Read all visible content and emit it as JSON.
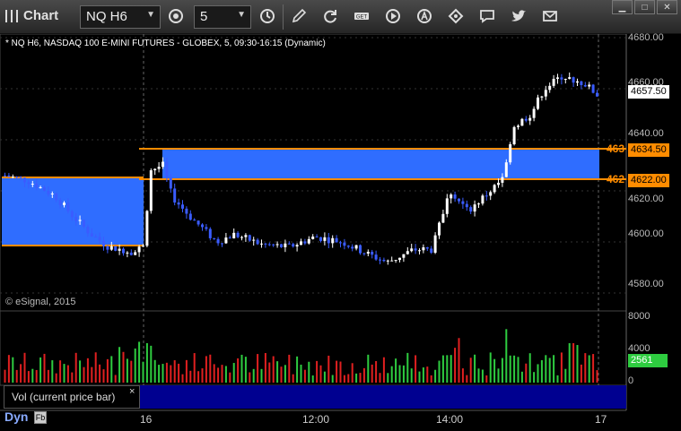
{
  "toolbar": {
    "app_title": "Chart",
    "symbol": "NQ H6",
    "interval": "5",
    "icons": [
      "chart-grid-icon",
      "dropdown-arrow-icon",
      "symbol-settings-icon",
      "dropdown-arrow-icon",
      "clock-icon",
      "pencil-icon",
      "refresh-icon",
      "get-icon",
      "play-icon",
      "alert-icon",
      "link-icon",
      "comment-icon",
      "twitter-icon",
      "mail-icon"
    ]
  },
  "chart": {
    "title": "* NQ H6, NASDAQ 100 E-MINI FUTURES - GLOBEX, 5, 09:30-16:15 (Dynamic)",
    "copyright": "© eSignal, 2015",
    "price_labels": [
      "4680.00",
      "4660.00",
      "4640.00",
      "4620.00",
      "4600.00",
      "4580.00"
    ],
    "last_price": "4657.50",
    "level_high": "4634.50",
    "level_low": "4622.00",
    "level_high_short": "463",
    "level_low_short": "462",
    "time_labels": [
      "16",
      "12:00",
      "14:00",
      "17"
    ],
    "colors": {
      "up": "#ffffff",
      "down": "#3a5cff",
      "zone": "#2f6dff",
      "level": "#ff8c00",
      "vol_up": "#2ecc40",
      "vol_down": "#e02020"
    }
  },
  "volume": {
    "label": "Vol (current price bar)",
    "close": "×",
    "axis_labels": [
      "8000",
      "4000",
      "0"
    ],
    "current": "2561"
  },
  "footer": {
    "dyn": "Dyn",
    "dyn_icon": "Fb"
  }
}
